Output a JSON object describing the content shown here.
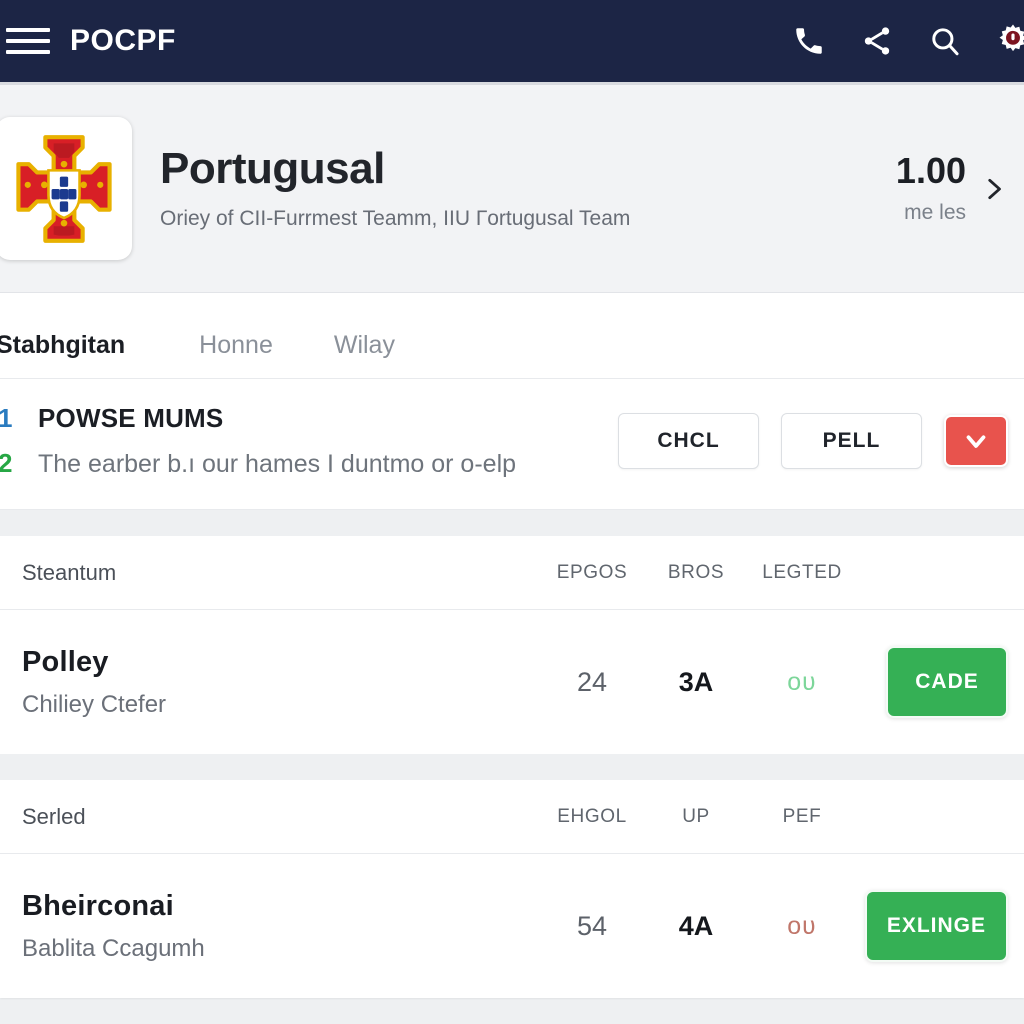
{
  "topbar": {
    "title": "POCPF",
    "menu_icon": "hamburger-menu-icon",
    "actions": [
      {
        "name": "phone-icon",
        "label": ""
      },
      {
        "name": "share-icon",
        "label": ""
      },
      {
        "name": "search-icon",
        "label": ""
      },
      {
        "name": "gear-icon",
        "label": ""
      }
    ],
    "bg_color": "#1c2545"
  },
  "hero": {
    "crest_alt": "portugal-crest",
    "title": "Portugusal",
    "subtitle": "Oriey of CII-Furrmest Teamm, IIU Гortugusal Team",
    "value": "1.00",
    "unit": "me les",
    "chevron": "chevron-right-icon"
  },
  "tabs": [
    {
      "label": "Stabhgitan",
      "active": true
    },
    {
      "label": "Honne",
      "active": false
    },
    {
      "label": "Wilay",
      "active": false
    }
  ],
  "list": {
    "items": [
      {
        "num": "1",
        "text": "POWSE MUMS",
        "num_color": "#2a7bbf",
        "style": "main"
      },
      {
        "num": "2",
        "text": "The earber b.ı our hames I duntmo or o-elp",
        "num_color": "#27a745",
        "style": "secondary"
      }
    ],
    "actions": {
      "button_1": "CHCL",
      "button_2": "PELL",
      "dropdown_icon": "chevron-down-icon",
      "dropdown_color": "#e8534d"
    }
  },
  "cards": [
    {
      "head_title": "Steantum",
      "columns": [
        "EPGOS",
        "BROS",
        "LEGTED"
      ],
      "row": {
        "title": "Polley",
        "subtitle": "Chiliey Ctefer",
        "col1": "24",
        "col2": "3A",
        "col3": "oʋ",
        "col3_color": "#7dd69a",
        "action_label": "CADE",
        "action_color": "#35b055"
      }
    },
    {
      "head_title": "Serled",
      "columns": [
        "EHGOL",
        "UP",
        "PEF"
      ],
      "row": {
        "title": "Bheirconai",
        "subtitle": "Bablita Ccagumh",
        "col1": "54",
        "col2": "4A",
        "col3": "oʋ",
        "col3_color": "#c0766a",
        "action_label": "EXLINGE",
        "action_color": "#35b055"
      }
    }
  ]
}
